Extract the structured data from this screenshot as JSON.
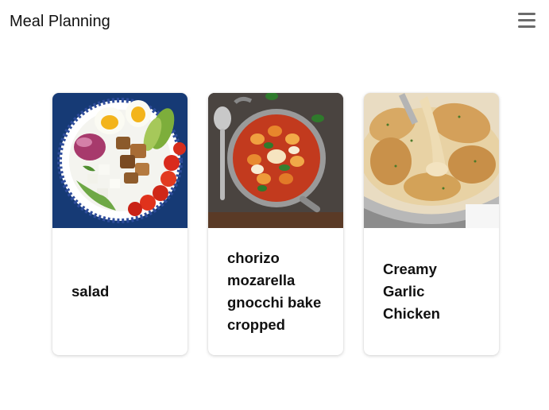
{
  "header": {
    "title": "Meal Planning",
    "menu_icon": "hamburger-menu-icon"
  },
  "recipes": [
    {
      "title": "salad",
      "image": "salad-bowl-photo"
    },
    {
      "title": "chorizo mozarella gnocchi bake cropped",
      "image": "gnocchi-bake-photo"
    },
    {
      "title": "Creamy Garlic Chicken",
      "image": "creamy-chicken-photo"
    }
  ],
  "colors": {
    "text": "#111111",
    "menu_icon": "#6b6b6b",
    "card_background": "#ffffff"
  }
}
